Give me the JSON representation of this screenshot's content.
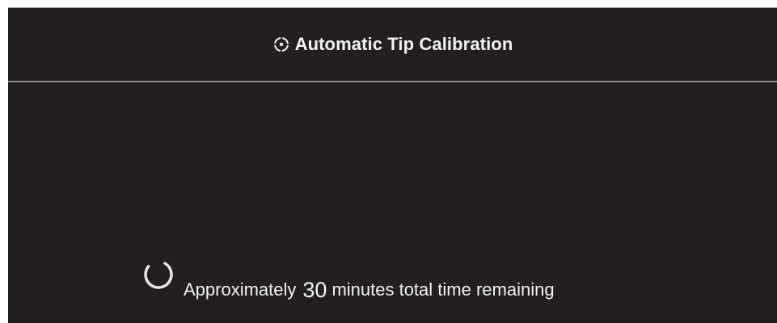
{
  "header": {
    "title": "Automatic Tip Calibration",
    "icon": "target-crosshair-icon"
  },
  "status": {
    "prefix": "Approximately",
    "minutes": "30",
    "suffix": "minutes total time remaining",
    "spinner_icon": "loading-spinner-icon"
  },
  "colors": {
    "background": "#231f20",
    "text": "#f2f2f2",
    "divider": "#8a8a8a"
  }
}
